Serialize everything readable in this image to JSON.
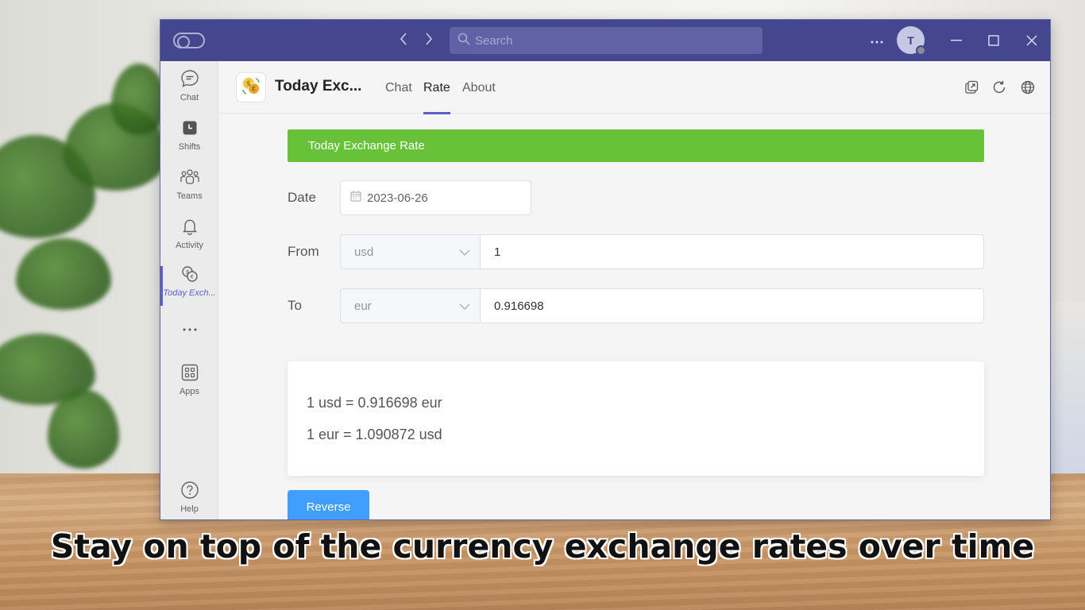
{
  "titlebar": {
    "search_placeholder": "Search",
    "avatar_initial": "T"
  },
  "rail": {
    "items": [
      {
        "label": "Chat",
        "icon": "chat-icon"
      },
      {
        "label": "Shifts",
        "icon": "clock-icon"
      },
      {
        "label": "Teams",
        "icon": "teams-icon"
      },
      {
        "label": "Activity",
        "icon": "bell-icon"
      },
      {
        "label": "Today Exch...",
        "icon": "exchange-app-icon"
      },
      {
        "label": "...",
        "icon": "more-icon"
      },
      {
        "label": "Apps",
        "icon": "apps-grid-icon"
      },
      {
        "label": "Help",
        "icon": "help-icon"
      }
    ],
    "active_item": "Today Exch..."
  },
  "app": {
    "name": "Today Exc...",
    "tabs": [
      {
        "label": "Chat"
      },
      {
        "label": "Rate"
      },
      {
        "label": "About"
      }
    ],
    "active_tab": "Rate"
  },
  "content": {
    "banner": "Today Exchange Rate",
    "date_label": "Date",
    "date_value": "2023-06-26",
    "from_label": "From",
    "from_currency": "usd",
    "from_amount": "1",
    "to_label": "To",
    "to_currency": "eur",
    "to_amount": "0.916698",
    "result_line_1": "1 usd = 0.916698 eur",
    "result_line_2": "1 eur = 1.090872 usd",
    "reverse_label": "Reverse"
  },
  "caption": "Stay on top of the currency exchange rates over time",
  "colors": {
    "titlebar": "#44478e",
    "accent": "#5b5fc7",
    "banner": "#67c23a",
    "button": "#409eff"
  }
}
